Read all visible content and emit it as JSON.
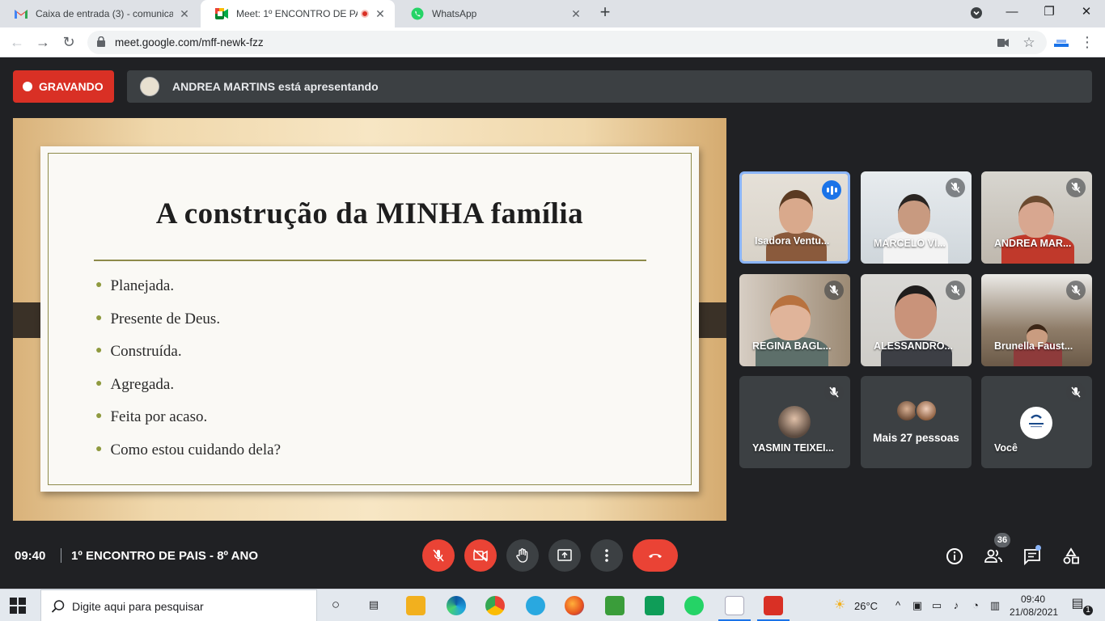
{
  "browser": {
    "tabs": [
      {
        "title": "Caixa de entrada (3) - comunicac",
        "icon": "gmail-icon",
        "active": false
      },
      {
        "title": "Meet: 1º ENCONTRO DE PAI",
        "icon": "meet-icon",
        "active": true
      },
      {
        "title": "WhatsApp",
        "icon": "whatsapp-icon",
        "active": false
      }
    ],
    "url": "meet.google.com/mff-newk-fzz"
  },
  "meet": {
    "recording_label": "GRAVANDO",
    "presenting_text": "ANDREA MARTINS está apresentando",
    "slide": {
      "title": "A construção da MINHA família",
      "bullets": [
        "Planejada.",
        "Presente de Deus.",
        "Construída.",
        "Agregada.",
        "Feita por acaso.",
        "Como estou cuidando dela?"
      ]
    },
    "participants": [
      {
        "name": "Isadora Ventu...",
        "state": "speaking"
      },
      {
        "name": "MARCELO VI...",
        "state": "muted"
      },
      {
        "name": "ANDREA MAR...",
        "state": "muted"
      },
      {
        "name": "REGINA BAGL...",
        "state": "muted"
      },
      {
        "name": "ALESSANDRO...",
        "state": "muted"
      },
      {
        "name": "Brunella Faust...",
        "state": "muted"
      },
      {
        "name": "YASMIN TEIXEI...",
        "state": "muted"
      },
      {
        "name": "Mais 27 pessoas",
        "state": "group"
      },
      {
        "name": "Você",
        "state": "muted"
      }
    ],
    "time": "09:40",
    "meeting_title": "1º ENCONTRO DE PAIS - 8º ANO",
    "participant_count": "36",
    "colors": {
      "accent": "#8ab4f8",
      "danger": "#ea4335",
      "surface": "#3c4043",
      "background": "#202124"
    }
  },
  "taskbar": {
    "search_placeholder": "Digite aqui para pesquisar",
    "weather": "26°C",
    "clock_time": "09:40",
    "clock_date": "21/08/2021",
    "notification_count": "1"
  }
}
